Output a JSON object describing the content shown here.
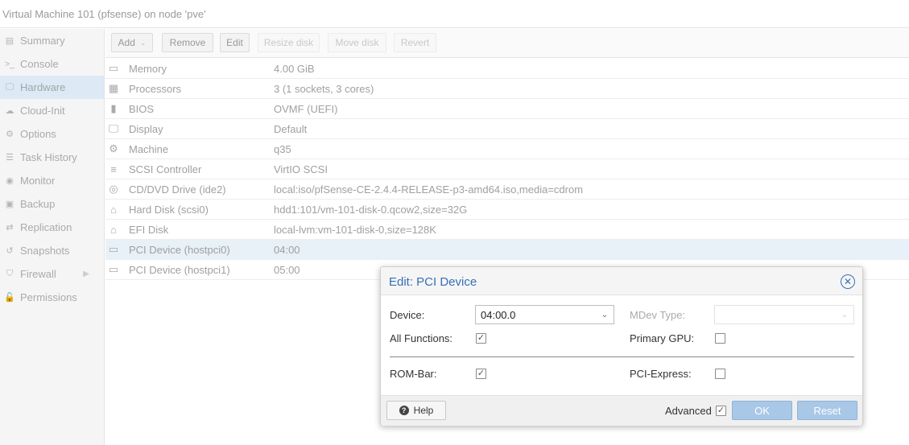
{
  "window": {
    "title": "Virtual Machine 101 (pfsense) on node 'pve'"
  },
  "sidebar": {
    "items": [
      {
        "label": "Summary",
        "icon": "book-icon",
        "glyph": "▤"
      },
      {
        "label": "Console",
        "icon": "terminal-icon",
        "glyph": ">_"
      },
      {
        "label": "Hardware",
        "icon": "desktop-icon",
        "glyph": "🖵"
      },
      {
        "label": "Cloud-Init",
        "icon": "cloud-icon",
        "glyph": "☁"
      },
      {
        "label": "Options",
        "icon": "gear-icon",
        "glyph": "⚙"
      },
      {
        "label": "Task History",
        "icon": "list-icon",
        "glyph": "☰"
      },
      {
        "label": "Monitor",
        "icon": "eye-icon",
        "glyph": "◉"
      },
      {
        "label": "Backup",
        "icon": "floppy-icon",
        "glyph": "▣"
      },
      {
        "label": "Replication",
        "icon": "retweet-icon",
        "glyph": "⇄"
      },
      {
        "label": "Snapshots",
        "icon": "history-icon",
        "glyph": "↺"
      },
      {
        "label": "Firewall",
        "icon": "shield-icon",
        "glyph": "⛉"
      },
      {
        "label": "Permissions",
        "icon": "unlock-icon",
        "glyph": "🔓"
      }
    ],
    "selected": "Hardware"
  },
  "toolbar": {
    "add": "Add",
    "remove": "Remove",
    "edit": "Edit",
    "resize_disk": "Resize disk",
    "move_disk": "Move disk",
    "revert": "Revert"
  },
  "hardware": {
    "rows": [
      {
        "name": "Memory",
        "value": "4.00 GiB",
        "icon": "memory-icon",
        "glyph": "▭"
      },
      {
        "name": "Processors",
        "value": "3 (1 sockets, 3 cores)",
        "icon": "cpu-icon",
        "glyph": "▦"
      },
      {
        "name": "BIOS",
        "value": "OVMF (UEFI)",
        "icon": "microchip-icon",
        "glyph": "▮"
      },
      {
        "name": "Display",
        "value": "Default",
        "icon": "monitor-icon",
        "glyph": "🖵"
      },
      {
        "name": "Machine",
        "value": "q35",
        "icon": "cogs-icon",
        "glyph": "⚙"
      },
      {
        "name": "SCSI Controller",
        "value": "VirtIO SCSI",
        "icon": "database-icon",
        "glyph": "≡"
      },
      {
        "name": "CD/DVD Drive (ide2)",
        "value": "local:iso/pfSense-CE-2.4.4-RELEASE-p3-amd64.iso,media=cdrom",
        "icon": "cdrom-icon",
        "glyph": "◎"
      },
      {
        "name": "Hard Disk (scsi0)",
        "value": "hdd1:101/vm-101-disk-0.qcow2,size=32G",
        "icon": "hdd-icon",
        "glyph": "⌂"
      },
      {
        "name": "EFI Disk",
        "value": "local-lvm:vm-101-disk-0,size=128K",
        "icon": "hdd-icon",
        "glyph": "⌂"
      },
      {
        "name": "PCI Device (hostpci0)",
        "value": "04:00",
        "icon": "pci-card-icon",
        "glyph": "▭"
      },
      {
        "name": "PCI Device (hostpci1)",
        "value": "05:00",
        "icon": "pci-card-icon",
        "glyph": "▭"
      }
    ],
    "selected_index": 9
  },
  "dialog": {
    "title": "Edit: PCI Device",
    "device_label": "Device:",
    "device_value": "04:00.0",
    "mdev_label": "MDev Type:",
    "mdev_value": "",
    "all_functions_label": "All Functions:",
    "all_functions_checked": true,
    "primary_gpu_label": "Primary GPU:",
    "primary_gpu_checked": false,
    "rombar_label": "ROM-Bar:",
    "rombar_checked": true,
    "pcie_label": "PCI-Express:",
    "pcie_checked": false,
    "help": "Help",
    "advanced_label": "Advanced",
    "advanced_checked": true,
    "ok": "OK",
    "reset": "Reset"
  },
  "colors": {
    "accent": "#3470b7",
    "selected_row": "#e8f0f8",
    "selected_nav": "#dde9f5",
    "primary_button": "#a9c7e6"
  }
}
